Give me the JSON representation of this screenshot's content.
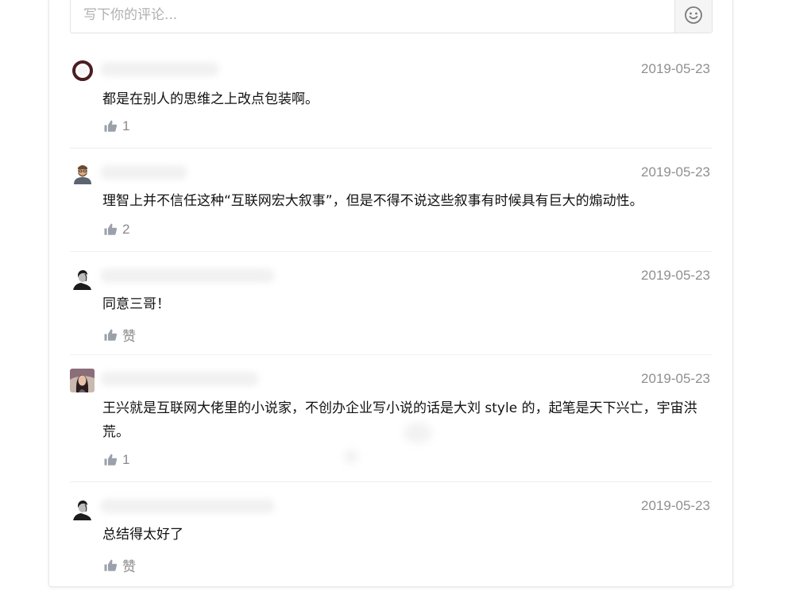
{
  "input": {
    "placeholder": "写下你的评论..."
  },
  "icons": {
    "emoji": "smile-face-icon",
    "like": "thumbs-up-icon"
  },
  "colors": {
    "date": "#8f8f8f",
    "like_icon": "#9aa1ab",
    "text": "#111111"
  },
  "comments": [
    {
      "date": "2019-05-23",
      "text": "都是在别人的思维之上改点包装啊。",
      "likes": "1"
    },
    {
      "date": "2019-05-23",
      "text": "理智上并不信任这种“互联网宏大叙事”，但是不得不说这些叙事有时候具有巨大的煽动性。",
      "likes": "2"
    },
    {
      "date": "2019-05-23",
      "text": "同意三哥！",
      "likes": "赞"
    },
    {
      "date": "2019-05-23",
      "text": "王兴就是互联网大佬里的小说家，不创办企业写小说的话是大刘 style 的，起笔是天下兴亡，宇宙洪荒。",
      "likes": "1"
    },
    {
      "date": "2019-05-23",
      "text": "总结得太好了",
      "likes": "赞"
    }
  ]
}
